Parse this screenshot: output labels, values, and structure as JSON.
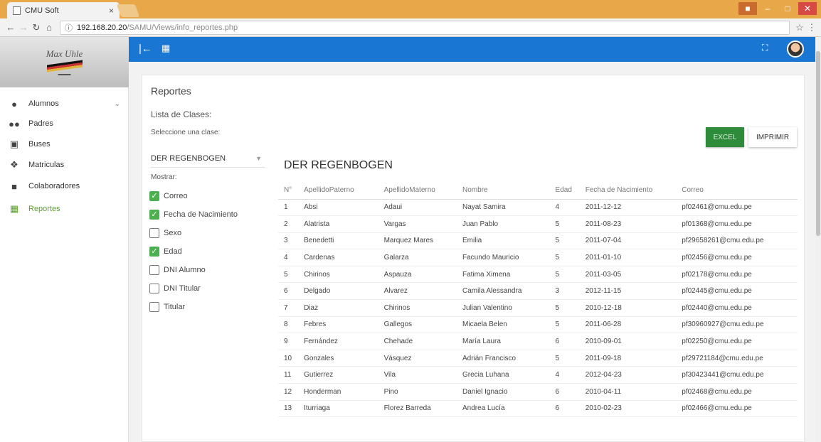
{
  "browser": {
    "tab_title": "CMU Soft",
    "tab_close": "×",
    "url_host": "192.168.20.20",
    "url_path": "/SAMU/Views/info_reportes.php"
  },
  "sidebar": {
    "logo_text": "Max Uhle",
    "items": [
      {
        "label": "Alumnos",
        "icon": "person-icon"
      },
      {
        "label": "Padres",
        "icon": "people-icon"
      },
      {
        "label": "Buses",
        "icon": "bus-icon"
      },
      {
        "label": "Matriculas",
        "icon": "info-icon"
      },
      {
        "label": "Colaboradores",
        "icon": "briefcase-icon"
      },
      {
        "label": "Reportes",
        "icon": "clipboard-icon"
      }
    ],
    "active_color": "#5aa02c"
  },
  "topbar": {
    "color": "#1976d2"
  },
  "content": {
    "title": "Reportes",
    "lista_label": "Lista de Clases:",
    "select_label": "Seleccione una clase:",
    "selected_class": "DER REGENBOGEN",
    "mostrar_label": "Mostrar:",
    "checkboxes": [
      {
        "label": "Correo",
        "checked": true
      },
      {
        "label": "Fecha de Nacimiento",
        "checked": true
      },
      {
        "label": "Sexo",
        "checked": false
      },
      {
        "label": "Edad",
        "checked": true
      },
      {
        "label": "DNI Alumno",
        "checked": false
      },
      {
        "label": "DNI Titular",
        "checked": false
      },
      {
        "label": "Titular",
        "checked": false
      }
    ],
    "excel_label": "EXCEL",
    "print_label": "IMPRIMIR",
    "table_heading": "DER REGENBOGEN",
    "table": {
      "headers": [
        "N°",
        "ApellidoPaterno",
        "ApellidoMaterno",
        "Nombre",
        "Edad",
        "Fecha de Nacimiento",
        "Correo"
      ],
      "rows": [
        [
          "1",
          "Absi",
          "Adaui",
          "Nayat Samira",
          "4",
          "2011-12-12",
          "pf02461@cmu.edu.pe"
        ],
        [
          "2",
          "Alatrista",
          "Vargas",
          "Juan Pablo",
          "5",
          "2011-08-23",
          "pf01368@cmu.edu.pe"
        ],
        [
          "3",
          "Benedetti",
          "Marquez Mares",
          "Emilia",
          "5",
          "2011-07-04",
          "pf29658261@cmu.edu.pe"
        ],
        [
          "4",
          "Cardenas",
          "Galarza",
          "Facundo Mauricio",
          "5",
          "2011-01-10",
          "pf02456@cmu.edu.pe"
        ],
        [
          "5",
          "Chirinos",
          "Aspauza",
          "Fatima Ximena",
          "5",
          "2011-03-05",
          "pf02178@cmu.edu.pe"
        ],
        [
          "6",
          "Delgado",
          "Alvarez",
          "Camila Alessandra",
          "3",
          "2012-11-15",
          "pf02445@cmu.edu.pe"
        ],
        [
          "7",
          "Diaz",
          "Chirinos",
          "Julian Valentino",
          "5",
          "2010-12-18",
          "pf02440@cmu.edu.pe"
        ],
        [
          "8",
          "Febres",
          "Gallegos",
          "Micaela Belen",
          "5",
          "2011-06-28",
          "pf30960927@cmu.edu.pe"
        ],
        [
          "9",
          "Fernández",
          "Chehade",
          "María Laura",
          "6",
          "2010-09-01",
          "pf02250@cmu.edu.pe"
        ],
        [
          "10",
          "Gonzales",
          "Vásquez",
          "Adrián Francisco",
          "5",
          "2011-09-18",
          "pf29721184@cmu.edu.pe"
        ],
        [
          "11",
          "Gutierrez",
          "Vila",
          "Grecia Luhana",
          "4",
          "2012-04-23",
          "pf30423441@cmu.edu.pe"
        ],
        [
          "12",
          "Honderman",
          "Pino",
          "Daniel Ignacio",
          "6",
          "2010-04-11",
          "pf02468@cmu.edu.pe"
        ],
        [
          "13",
          "Iturriaga",
          "Florez Barreda",
          "Andrea Lucía",
          "6",
          "2010-02-23",
          "pf02466@cmu.edu.pe"
        ]
      ]
    }
  }
}
